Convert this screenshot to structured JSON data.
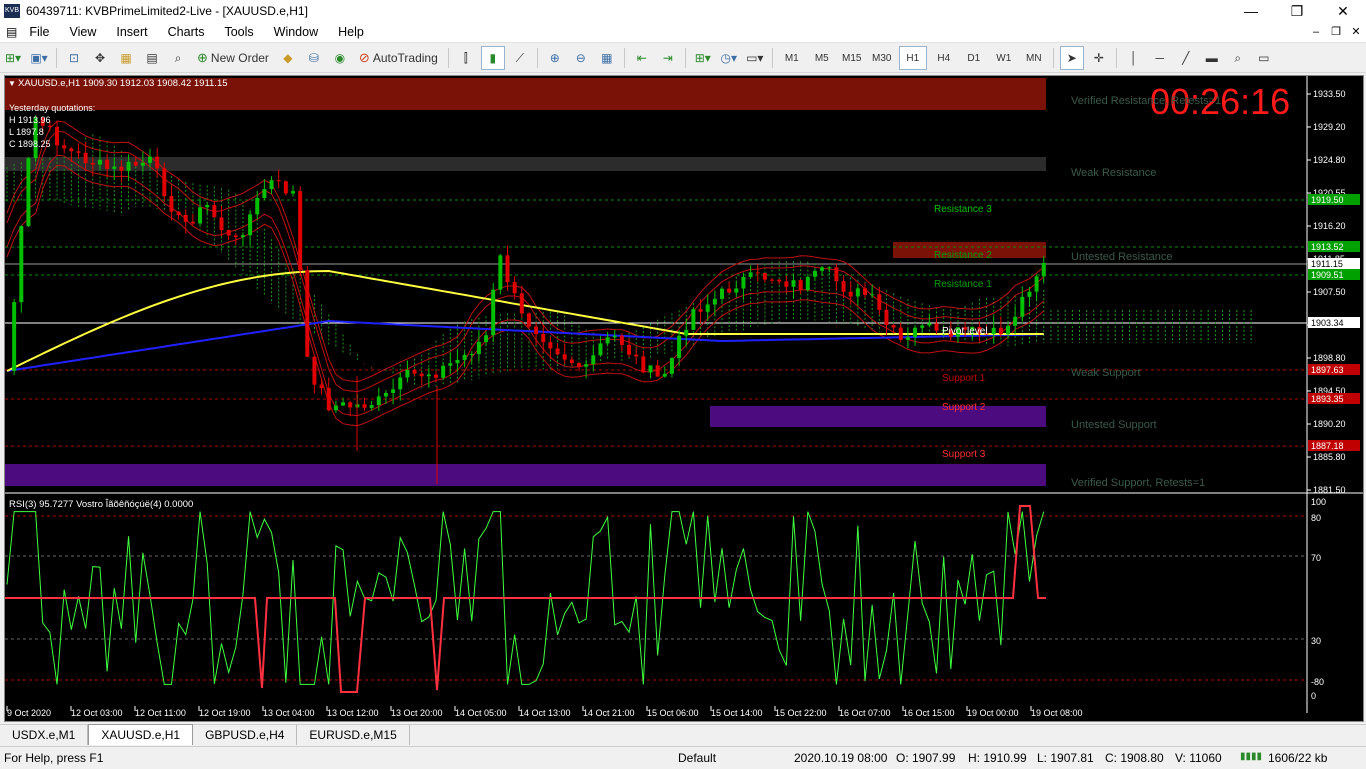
{
  "window": {
    "title": "60439711: KVBPrimeLimited2-Live - [XAUUSD.e,H1]",
    "app_icon_text": "KVB",
    "minimize": "—",
    "maximize": "❐",
    "close": "✕"
  },
  "menu": {
    "items": [
      "File",
      "View",
      "Insert",
      "Charts",
      "Tools",
      "Window",
      "Help"
    ],
    "mdi_minimize": "–",
    "mdi_restore": "❐",
    "mdi_close": "✕"
  },
  "toolbar": {
    "new_order": "New Order",
    "autotrading": "AutoTrading",
    "timeframes": [
      "M1",
      "M5",
      "M15",
      "M30",
      "H1",
      "H4",
      "D1",
      "W1",
      "MN"
    ],
    "active_timeframe": "H1"
  },
  "chart": {
    "header": "XAUUSD.e,H1  1909.30 1912.03 1908.42 1911.15",
    "yesterday": {
      "title": "Yesterday quotations:",
      "h": "H 1913.96",
      "l": "L 1897.8",
      "c": "C 1898.25"
    },
    "countdown": "00:26:16",
    "zones": {
      "verified_resistance": "Verified Resistance, Retests=1",
      "weak_resistance": "Weak Resistance",
      "untested_resistance": "Untested Resistance",
      "weak_support": "Weak Support",
      "untested_support": "Untested Support",
      "verified_support": "Verified Support, Retests=1"
    },
    "levels": {
      "r3": "Resistance 3",
      "r2": "Resistance 2",
      "r1": "Resistance 1",
      "pivot": "Pivot level",
      "s1": "Support 1",
      "s2": "Support 2",
      "s3": "Support 3"
    },
    "price_axis": [
      "1933.50",
      "1929.20",
      "1924.80",
      "1920.55",
      "1916.20",
      "1911.85",
      "1907.50",
      "1903.25",
      "1898.80",
      "1894.50",
      "1890.20",
      "1885.80",
      "1881.50"
    ],
    "price_tags": [
      {
        "text": "1919.50",
        "color": "#00a000"
      },
      {
        "text": "1913.52",
        "color": "#00a000"
      },
      {
        "text": "1911.15",
        "color": "#ffffff"
      },
      {
        "text": "1909.51",
        "color": "#00a000"
      },
      {
        "text": "1903.34",
        "color": "#ffffff"
      },
      {
        "text": "1897.63",
        "color": "#c00000"
      },
      {
        "text": "1893.35",
        "color": "#c00000"
      },
      {
        "text": "1887.18",
        "color": "#c00000"
      }
    ],
    "rsi_label": "RSI(3) 95.7277  Vostro Îãõêñóçúë(4) 0.0000",
    "rsi_axis": [
      "100",
      "80",
      "70",
      "30",
      "-80",
      "0"
    ],
    "time_axis": [
      "9 Oct 2020",
      "12 Oct 03:00",
      "12 Oct 11:00",
      "12 Oct 19:00",
      "13 Oct 04:00",
      "13 Oct 12:00",
      "13 Oct 20:00",
      "14 Oct 05:00",
      "14 Oct 13:00",
      "14 Oct 21:00",
      "15 Oct 06:00",
      "15 Oct 14:00",
      "15 Oct 22:00",
      "16 Oct 07:00",
      "16 Oct 15:00",
      "19 Oct 00:00",
      "19 Oct 08:00"
    ],
    "colors": {
      "bull": "#00c000",
      "bear": "#e00000",
      "ma_yellow": "#ffff40",
      "ma_blue": "#2020ff",
      "countdown": "#ff1a1a"
    }
  },
  "tabs": [
    "USDX.e,M1",
    "XAUUSD.e,H1",
    "GBPUSD.e,H4",
    "EURUSD.e,M15"
  ],
  "active_tab": "XAUUSD.e,H1",
  "status": {
    "help": "For Help, press F1",
    "profile": "Default",
    "datetime": "2020.10.19 08:00",
    "open": "O: 1907.99",
    "high": "H: 1910.99",
    "low": "L: 1907.81",
    "close": "C: 1908.80",
    "volume": "V: 11060",
    "traffic": "1606/22 kb"
  }
}
